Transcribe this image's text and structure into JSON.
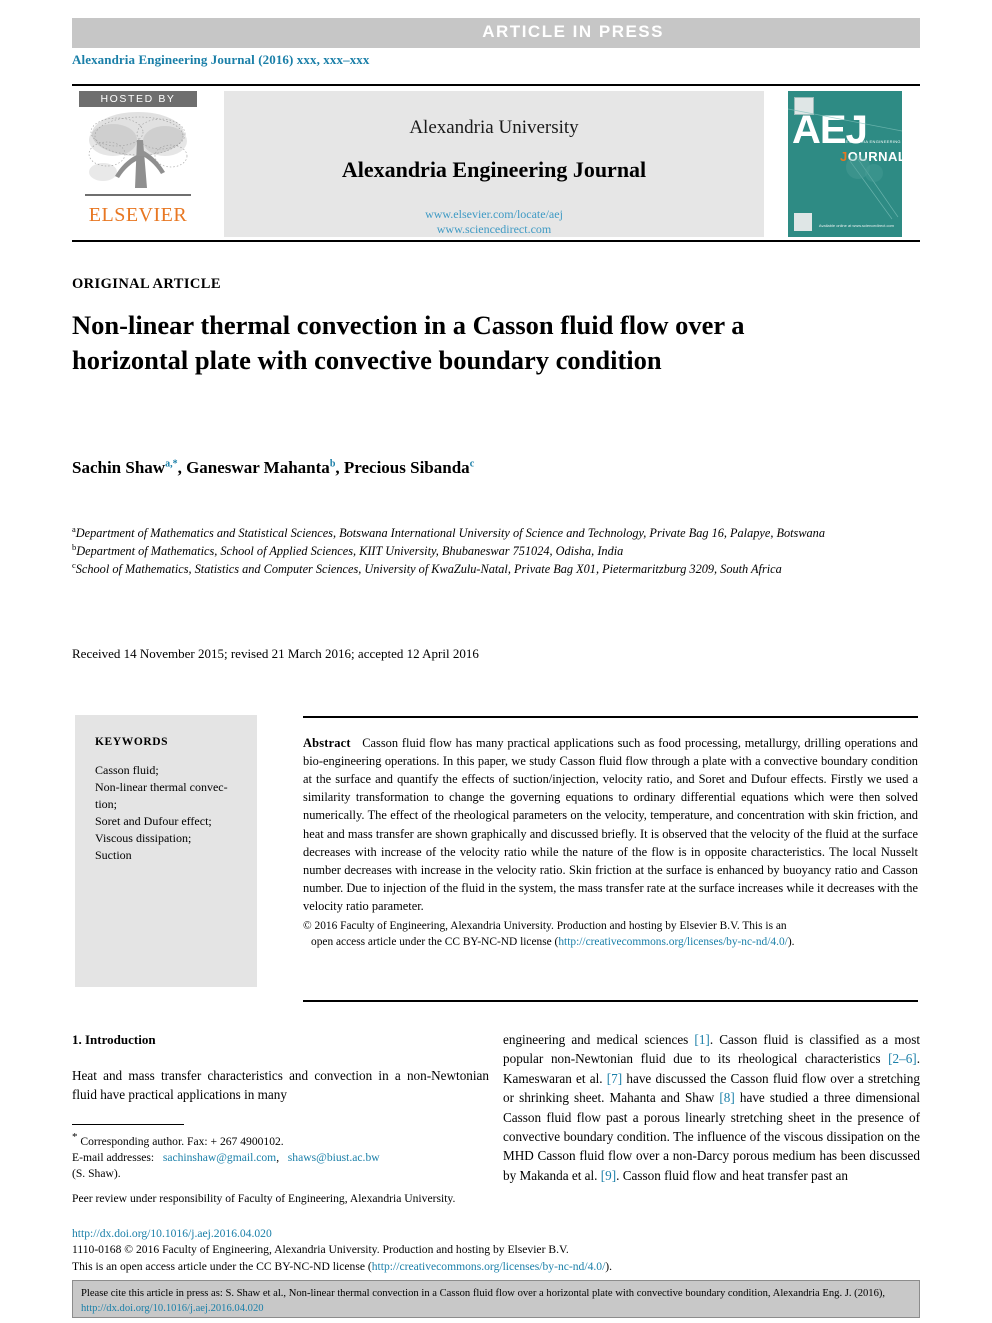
{
  "banner": {
    "text": "ARTICLE  IN  PRESS"
  },
  "journal_line": "Alexandria Engineering Journal (2016) xxx, xxx–xxx",
  "masthead": {
    "hosted_by": "HOSTED BY",
    "publisher": "ELSEVIER",
    "university": "Alexandria University",
    "journal_name": "Alexandria Engineering Journal",
    "link1": "www.elsevier.com/locate/aej",
    "link2": "www.sciencedirect.com",
    "cover": {
      "initials": "AEJ",
      "journal_word": "OURNAL",
      "journal_initial": "J",
      "top_small_text": "ALEXANDRIA ENGINEERING",
      "footer_text": "Available online at www.sciencedirect.com"
    },
    "colors": {
      "cover_bg": "#2e8b84",
      "elsevier_orange": "#e87722",
      "panel_grey": "#e6e6e6",
      "hosted_grey": "#6e6e6e"
    }
  },
  "article": {
    "type_label": "ORIGINAL ARTICLE",
    "title": "Non-linear thermal convection in a Casson fluid flow over a horizontal plate with convective boundary condition",
    "authors": [
      {
        "name": "Sachin Shaw",
        "marks": "a,*"
      },
      {
        "name": "Ganeswar Mahanta",
        "marks": "b"
      },
      {
        "name": "Precious Sibanda",
        "marks": "c"
      }
    ],
    "affiliations": [
      {
        "mark": "a",
        "text": "Department of Mathematics and Statistical Sciences, Botswana International University of Science and Technology, Private Bag 16, Palapye, Botswana"
      },
      {
        "mark": "b",
        "text": "Department of Mathematics, School of Applied Sciences, KIIT University, Bhubaneswar 751024, Odisha, India"
      },
      {
        "mark": "c",
        "text": "School of Mathematics, Statistics and Computer Sciences, University of KwaZulu-Natal, Private Bag X01, Pietermaritzburg 3209, South Africa"
      }
    ],
    "history": "Received 14 November 2015; revised 21 March 2016; accepted 12 April 2016"
  },
  "keywords": {
    "heading": "KEYWORDS",
    "items": "Casson fluid;\nNon-linear thermal convec-\ntion;\nSoret and Dufour effect;\nViscous dissipation;\nSuction"
  },
  "abstract": {
    "label": "Abstract",
    "body": "Casson fluid flow has many practical applications such as food processing, metallurgy, drilling operations and bio-engineering operations. In this paper, we study Casson fluid flow through a plate with a convective boundary condition at the surface and quantify the effects of suction/injection, velocity ratio, and Soret and Dufour effects. Firstly we used a similarity transformation to change the governing equations to ordinary differential equations which were then solved numerically. The effect of the rheological parameters on the velocity, temperature, and concentration with skin friction, and heat and mass transfer are shown graphically and discussed briefly. It is observed that the velocity of the fluid at the surface decreases with increase of the velocity ratio while the nature of the flow is in opposite characteristics. The local Nusselt number decreases with increase in the velocity ratio. Skin friction at the surface is enhanced by buoyancy ratio and Casson number. Due to injection of the fluid in the system, the mass transfer rate at the surface increases while it decreases with the velocity ratio parameter.",
    "copyright_line1": "© 2016 Faculty of Engineering, Alexandria University. Production and hosting by Elsevier B.V. This is an",
    "copyright_line2_pre": "open access article under the CC BY-NC-ND license (",
    "copyright_link": "http://creativecommons.org/licenses/by-nc-nd/4.0/",
    "copyright_line2_post": ")."
  },
  "body": {
    "section_heading": "1. Introduction",
    "left_paragraph": "Heat and mass transfer characteristics and convection in a non-Newtonian fluid have practical applications in many",
    "right_paragraph_parts": [
      {
        "t": "engineering and medical sciences "
      },
      {
        "ref": "[1]"
      },
      {
        "t": ". Casson fluid is classified as a most popular non-Newtonian fluid due to its rheological characteristics "
      },
      {
        "ref": "[2–6]"
      },
      {
        "t": ". Kameswaran et al. "
      },
      {
        "ref": "[7]"
      },
      {
        "t": " have discussed the Casson fluid flow over a stretching or shrinking sheet. Mahanta and Shaw "
      },
      {
        "ref": "[8]"
      },
      {
        "t": " have studied a three dimensional Casson fluid flow past a porous linearly stretching sheet in the presence of convective boundary condition. The influence of the viscous dissipation on the MHD Casson fluid flow over a non-Darcy porous medium has been discussed by Makanda et al. "
      },
      {
        "ref": "[9]"
      },
      {
        "t": ". Casson fluid flow and heat transfer past an"
      }
    ]
  },
  "footnotes": {
    "corresponding": "Corresponding author. Fax: + 267 4900102.",
    "email_label": "E-mail addresses:",
    "email1": "sachinshaw@gmail.com",
    "email2": "shaws@biust.ac.bw",
    "email_owner": "(S. Shaw).",
    "peer_review": "Peer review under responsibility of Faculty of Engineering, Alexandria University."
  },
  "doi_block": {
    "doi": "http://dx.doi.org/10.1016/j.aej.2016.04.020",
    "line1": "1110-0168 © 2016 Faculty of Engineering, Alexandria University. Production and hosting by Elsevier B.V.",
    "line2_pre": "This is an open access article under the CC BY-NC-ND license (",
    "line2_link": "http://creativecommons.org/licenses/by-nc-nd/4.0/",
    "line2_post": ")."
  },
  "cite_box": {
    "line1": "Please cite this article in press as: S. Shaw et al., Non-linear thermal convection in a Casson fluid flow over a horizontal plate with convective boundary condition,",
    "line2_pre": "Alexandria Eng. J. (2016), ",
    "line2_link": "http://dx.doi.org/10.1016/j.aej.2016.04.020"
  }
}
